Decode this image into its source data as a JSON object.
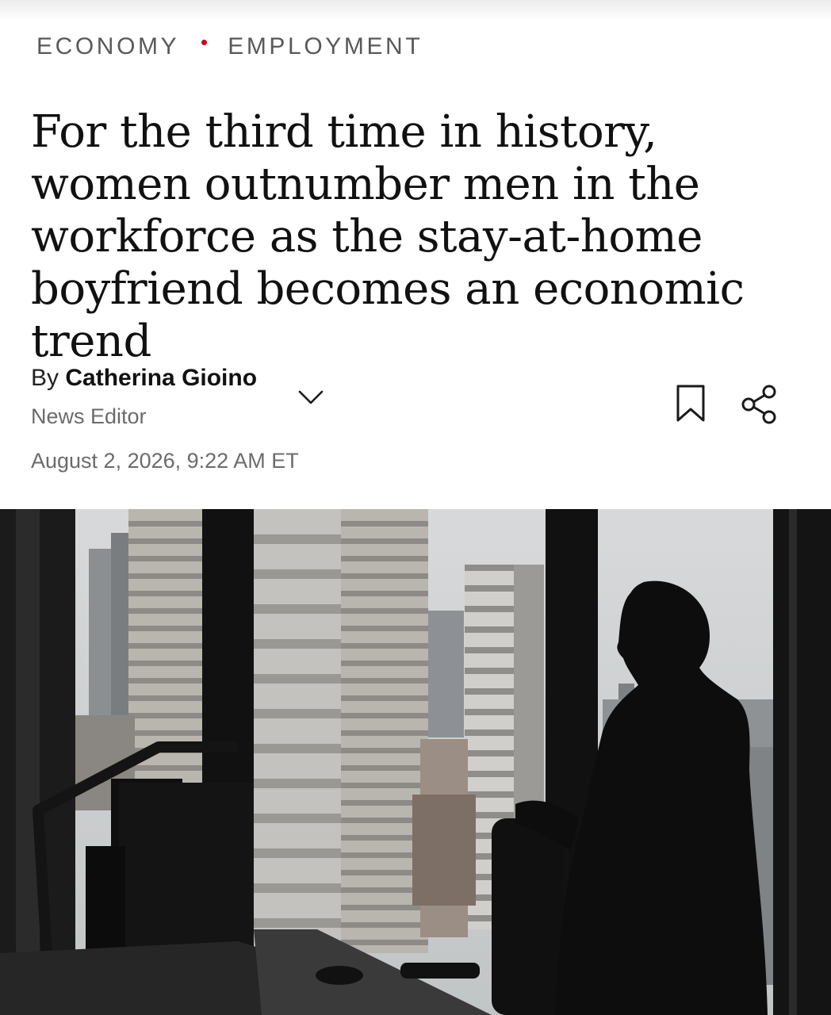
{
  "breadcrumb": {
    "section": "ECONOMY",
    "subsection": "EMPLOYMENT",
    "separator_color": "#d0021b"
  },
  "article": {
    "headline": "For the third time in history, women outnumber men in the workforce as the stay-at-home boyfriend becomes an economic trend",
    "byline_prefix": "By",
    "author": "Catherina Gioino",
    "author_role": "News Editor",
    "published": "August 2, 2026, 9:22 AM ET"
  },
  "actions": {
    "expand_icon": "chevron-down-icon",
    "bookmark_icon": "bookmark-icon",
    "share_icon": "share-icon"
  },
  "hero_image": {
    "subject": "silhouette of a woman standing at an office window overlooking city towers"
  }
}
